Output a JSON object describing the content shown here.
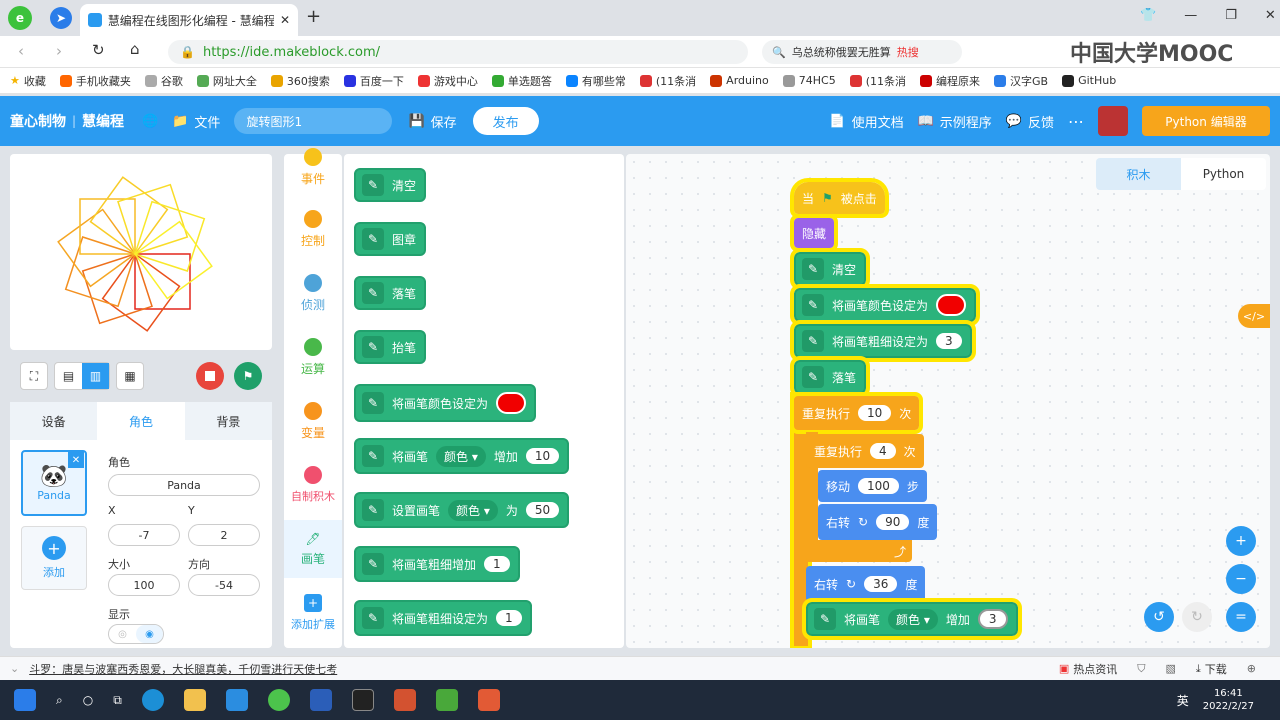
{
  "browser": {
    "tab_title": "慧编程在线图形化编程 - 慧编程",
    "url": "https://ide.makeblock.com/",
    "search_text": "乌总统称俄罢无胜算",
    "search_badge": "热搜",
    "watermark": "中国大学MOOC",
    "bookmarks": [
      "收藏",
      "手机收藏夹",
      "谷歌",
      "网址大全",
      "360搜索",
      "百度一下",
      "游戏中心",
      "单选题答",
      "有哪些常",
      "(11条消",
      "Arduino",
      "74HC5",
      "(11条消",
      "编程原来",
      "汉字GB",
      "GitHub"
    ]
  },
  "app": {
    "brand": "童心制物",
    "product": "慧编程",
    "file_label": "文件",
    "project_name": "旋转图形1",
    "save_label": "保存",
    "publish_label": "发布",
    "docs_label": "使用文档",
    "examples_label": "示例程序",
    "feedback_label": "反馈",
    "python_editor_label": "Python 编辑器"
  },
  "left_panel": {
    "tabs": [
      "设备",
      "角色",
      "背景"
    ],
    "sprite_name_label": "角色",
    "sprite_name": "Panda",
    "x_label": "X",
    "x": "-7",
    "y_label": "Y",
    "y": "2",
    "size_label": "大小",
    "size": "100",
    "direction_label": "方向",
    "direction": "-54",
    "show_label": "显示",
    "sprite_card_name": "Panda",
    "add_label": "添加"
  },
  "categories": [
    {
      "label": "事件",
      "color": "#f7c21b"
    },
    {
      "label": "控制",
      "color": "#f7a51b"
    },
    {
      "label": "侦测",
      "color": "#4ea3d8"
    },
    {
      "label": "运算",
      "color": "#49b84a"
    },
    {
      "label": "变量",
      "color": "#f7941d"
    },
    {
      "label": "自制积木",
      "color": "#f0506e"
    },
    {
      "label": "画笔",
      "color": "#2bb37c"
    },
    {
      "label": "添加扩展",
      "color": "#2b9bf0"
    }
  ],
  "palette": {
    "clear": "清空",
    "stamp": "图章",
    "pen_down": "落笔",
    "pen_up": "抬笔",
    "set_color": "将画笔颜色设定为",
    "change_pen": "将画笔",
    "color_param": "颜色",
    "change_by": "增加",
    "change_value": "10",
    "set_pen": "设置画笔",
    "to": "为",
    "set_value": "50",
    "change_size": "将画笔粗细增加",
    "change_size_value": "1",
    "set_size": "将画笔粗细设定为",
    "set_size_value": "1"
  },
  "script": {
    "when": "当",
    "clicked": "被点击",
    "hide": "隐藏",
    "clear": "清空",
    "set_color": "将画笔颜色设定为",
    "set_size": "将画笔粗细设定为",
    "size_value": "3",
    "pen_down": "落笔",
    "repeat": "重复执行",
    "outer_times": "10",
    "times": "次",
    "inner_times": "4",
    "move": "移动",
    "steps_value": "100",
    "steps": "步",
    "turn_right": "右转",
    "inner_angle": "90",
    "degrees": "度",
    "outer_angle": "36",
    "change_pen": "将画笔",
    "color_param": "颜色",
    "change_by": "增加",
    "change_value": "3"
  },
  "view_tabs": [
    "积木",
    "Python"
  ],
  "news_text": "斗罗：唐昊与波塞西秀恩爱，大长腿真美，千仞雪进行天使七考",
  "status_items": [
    "热点资讯",
    "下载"
  ],
  "taskbar": {
    "time": "16:41",
    "date": "2022/2/27",
    "ime": "英"
  }
}
